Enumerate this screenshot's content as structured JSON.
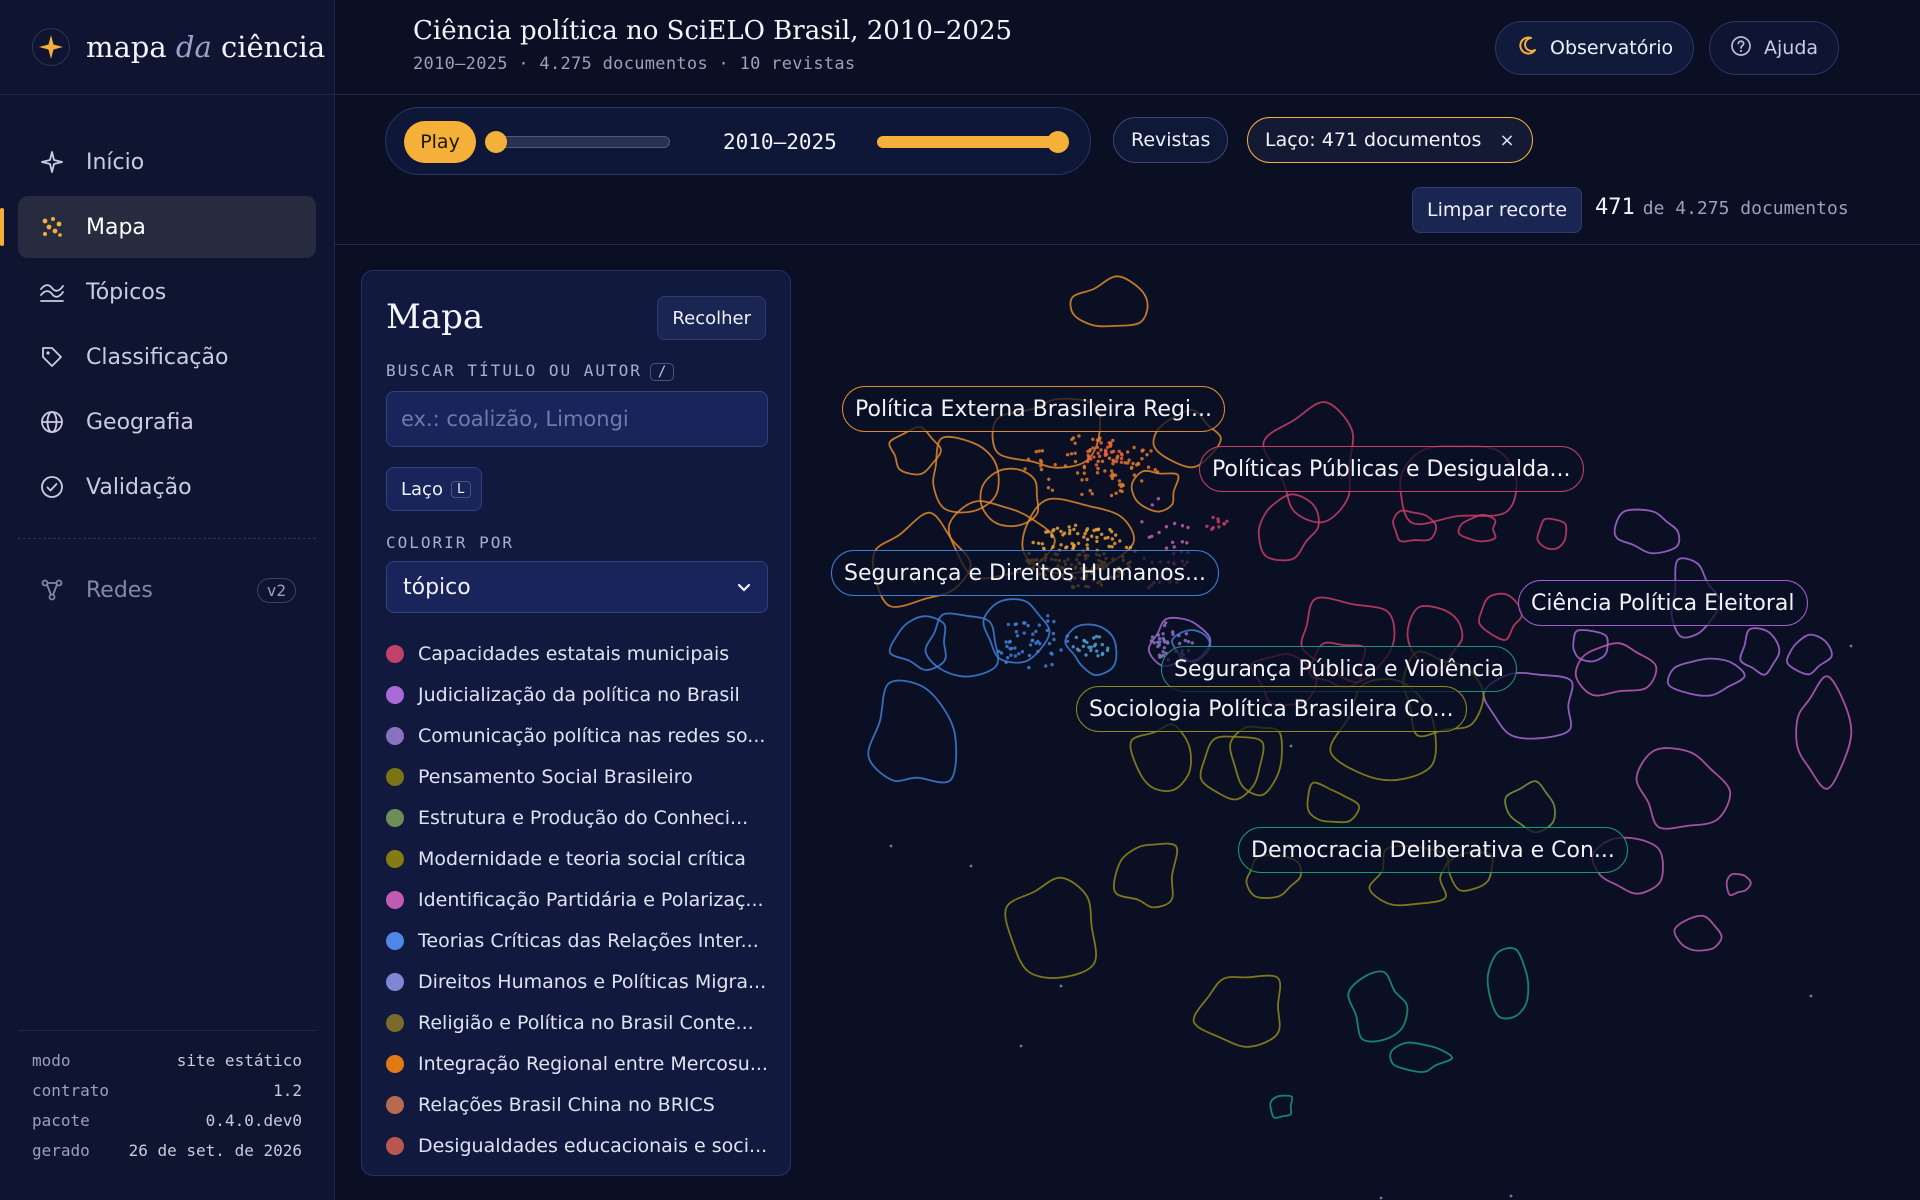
{
  "brand": {
    "name_a": "mapa",
    "name_b": "da",
    "name_c": "ciência"
  },
  "nav": {
    "items": [
      {
        "label": "Início",
        "icon": "sparkle-icon"
      },
      {
        "label": "Mapa",
        "icon": "scatter-icon"
      },
      {
        "label": "Tópicos",
        "icon": "waves-icon"
      },
      {
        "label": "Classificação",
        "icon": "tag-icon"
      },
      {
        "label": "Geografia",
        "icon": "globe-icon"
      },
      {
        "label": "Validação",
        "icon": "check-circle-icon"
      }
    ],
    "disabled_item": {
      "label": "Redes",
      "badge": "v2",
      "icon": "network-icon"
    }
  },
  "meta": [
    {
      "key": "modo",
      "value": "site estático"
    },
    {
      "key": "contrato",
      "value": "1.2"
    },
    {
      "key": "pacote",
      "value": "0.4.0.dev0"
    },
    {
      "key": "gerado",
      "value": "26 de set. de 2026"
    }
  ],
  "header": {
    "title": "Ciência política no SciELO Brasil, 2010–2025",
    "subtitle": "2010–2025 · 4.275 documentos · 10 revistas",
    "observatory_label": "Observatório",
    "help_label": "Ajuda"
  },
  "toolbar": {
    "play_label": "Play",
    "range_label": "2010–2025",
    "left_slider_value": 0,
    "right_slider_value": 1,
    "journals_label": "Revistas",
    "lasso_pill_label": "Laço: 471 documentos",
    "lasso_pill_close": "×",
    "clear_label": "Limpar recorte",
    "count_value": "471",
    "count_suffix": "de 4.275 documentos"
  },
  "panel": {
    "title": "Mapa",
    "collapse_label": "Recolher",
    "search_label": "BUSCAR TÍTULO OU AUTOR",
    "search_shortcut": "/",
    "search_placeholder": "ex.: coalizão, Limongi",
    "search_value": "",
    "lasso_label": "Laço",
    "lasso_shortcut": "L",
    "color_label": "COLORIR POR",
    "color_value": "tópico"
  },
  "legend": [
    {
      "label": "Capacidades estatais municipais",
      "color": "#c2416a"
    },
    {
      "label": "Judicialização da política no Brasil",
      "color": "#a86ad6"
    },
    {
      "label": "Comunicação política nas redes so...",
      "color": "#8a72c2"
    },
    {
      "label": "Pensamento Social Brasileiro",
      "color": "#7a7412"
    },
    {
      "label": "Estrutura e Produção do Conheci...",
      "color": "#6e8e58"
    },
    {
      "label": "Modernidade e teoria social crítica",
      "color": "#827c12"
    },
    {
      "label": "Identificação Partidária e Polarizaç...",
      "color": "#c25cb3"
    },
    {
      "label": "Teorias Críticas das Relações Inter...",
      "color": "#4f86e8"
    },
    {
      "label": "Direitos Humanos e Políticas Migra...",
      "color": "#7f86d4"
    },
    {
      "label": "Religião e Política no Brasil Conte...",
      "color": "#7a6b2c"
    },
    {
      "label": "Integração Regional entre Mercosu...",
      "color": "#e07a12"
    },
    {
      "label": "Relações Brasil China no BRICS",
      "color": "#b86a4f"
    },
    {
      "label": "Desigualdades educacionais e soci...",
      "color": "#b8564f"
    }
  ],
  "clusters": [
    {
      "label": "Política Externa Brasileira Regi...",
      "color": "#e08a2a"
    },
    {
      "label": "Políticas Públicas e Desigualda...",
      "color": "#c93d66"
    },
    {
      "label": "Segurança e Direitos Humanos...",
      "color": "#3f7fd6"
    },
    {
      "label": "Ciência Política Eleitoral",
      "color": "#a45ec9"
    },
    {
      "label": "Segurança Pública e Violência",
      "color": "#1f8f7e"
    },
    {
      "label": "Sociologia Política Brasileira Co...",
      "color": "#8f8a1a"
    },
    {
      "label": "Democracia Deliberativa e Con...",
      "color": "#1a9a73"
    }
  ]
}
